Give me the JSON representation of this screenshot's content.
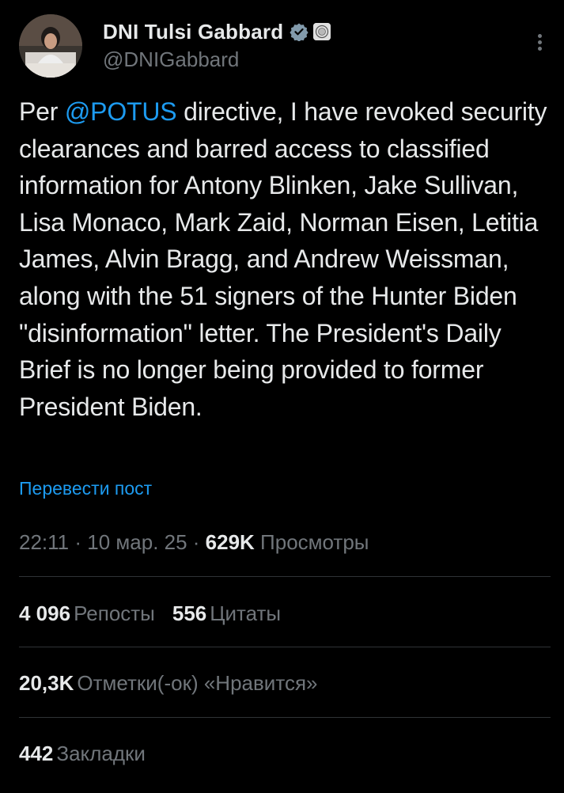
{
  "author": {
    "display_name": "DNI Tulsi Gabbard",
    "handle": "@DNIGabbard",
    "verified_icon": "verified-check-icon",
    "affiliate_icon": "government-seal-icon"
  },
  "tweet": {
    "prefix": "Per ",
    "mention": "@POTUS",
    "body": " directive, I have revoked security clearances and barred access to classified information for Antony Blinken, Jake Sullivan, Lisa Monaco, Mark Zaid, Norman Eisen, Letitia James, Alvin Bragg, and Andrew Weissman, along with the 51 signers of the Hunter Biden \"disinformation\" letter. The President's Daily Brief is no longer being provided to former President Biden."
  },
  "translate_label": "Перевести пост",
  "meta": {
    "time": "22:11",
    "separator": " · ",
    "date": "10 мар. 25",
    "views_count": "629K",
    "views_label": " Просмотры"
  },
  "stats": {
    "reposts_count": "4 096",
    "reposts_label": "Репосты",
    "quotes_count": "556",
    "quotes_label": "Цитаты",
    "likes_count": "20,3K",
    "likes_label": "Отметки(-ок) «Нравится»",
    "bookmarks_count": "442",
    "bookmarks_label": "Закладки"
  },
  "colors": {
    "background": "#000000",
    "text": "#e7e9ea",
    "secondary": "#71767b",
    "accent": "#1d9bf0",
    "divider": "#2f3336"
  }
}
